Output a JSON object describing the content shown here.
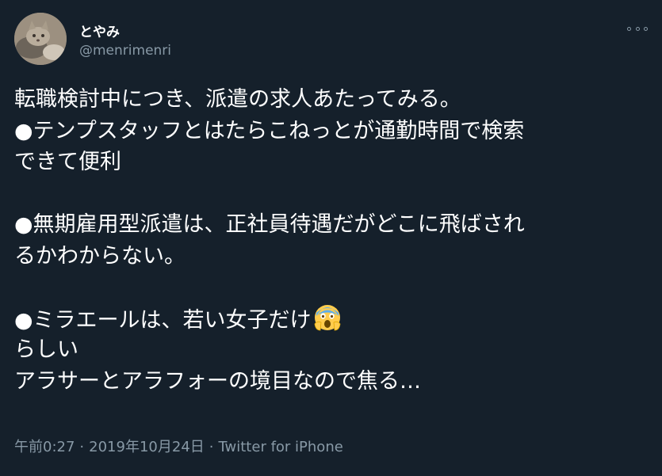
{
  "user": {
    "display_name": "とやみ",
    "handle": "@menrimenri",
    "avatar_icon": "cat-avatar-icon"
  },
  "more_icon": "more-options-icon",
  "tweet": {
    "line1": "転職検討中につき、派遣の求人あたってみる。",
    "line2": "●テンプスタッフとはたらこねっとが通勤時間で検索",
    "line3": "できて便利",
    "line4": "●無期雇用型派遣は、正社員待遇だがどこに飛ばされ",
    "line5": "るかわからない。",
    "line6": "●ミラエールは、若い女子だけ",
    "emoji": "screaming-face-emoji",
    "line7": "らしい",
    "line8": "アラサーとアラフォーの境目なので焦る…"
  },
  "meta": {
    "time": "午前0:27",
    "separator": "·",
    "date": "2019年10月24日",
    "source": "Twitter for iPhone"
  },
  "colors": {
    "background": "#15202b",
    "text_primary": "#ffffff",
    "text_secondary": "#8899a6"
  }
}
